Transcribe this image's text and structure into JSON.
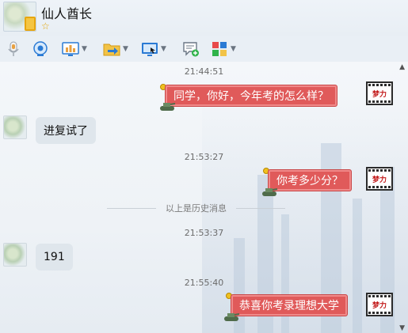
{
  "header": {
    "contact_name": "仙人酋长",
    "star_badge": "☆"
  },
  "toolbar": {
    "items": [
      {
        "name": "voice-call",
        "has_dropdown": false
      },
      {
        "name": "video-call",
        "has_dropdown": false
      },
      {
        "name": "remote-assist",
        "has_dropdown": true
      },
      {
        "name": "send-file",
        "has_dropdown": true
      },
      {
        "name": "screen-share",
        "has_dropdown": true
      },
      {
        "name": "create-group",
        "has_dropdown": false
      },
      {
        "name": "apps",
        "has_dropdown": true
      }
    ]
  },
  "chat": {
    "messages": [
      {
        "type": "timestamp",
        "text": "21:44:51"
      },
      {
        "type": "outgoing",
        "text": "同学，你好，今年考的怎么样？"
      },
      {
        "type": "incoming",
        "text": "进复试了"
      },
      {
        "type": "timestamp",
        "text": "21:53:27"
      },
      {
        "type": "outgoing",
        "text": "你考多少分？"
      },
      {
        "type": "divider",
        "text": "以上是历史消息"
      },
      {
        "type": "timestamp",
        "text": "21:53:37"
      },
      {
        "type": "incoming",
        "text": "191"
      },
      {
        "type": "timestamp",
        "text": "21:55:40"
      },
      {
        "type": "outgoing",
        "text": "恭喜你考录理想大学"
      }
    ],
    "my_avatar_text": "梦力"
  },
  "colors": {
    "outgoing_bubble": "#e05a5a",
    "incoming_bubble": "#dfe6ec",
    "accent": "#2a7ad4"
  }
}
